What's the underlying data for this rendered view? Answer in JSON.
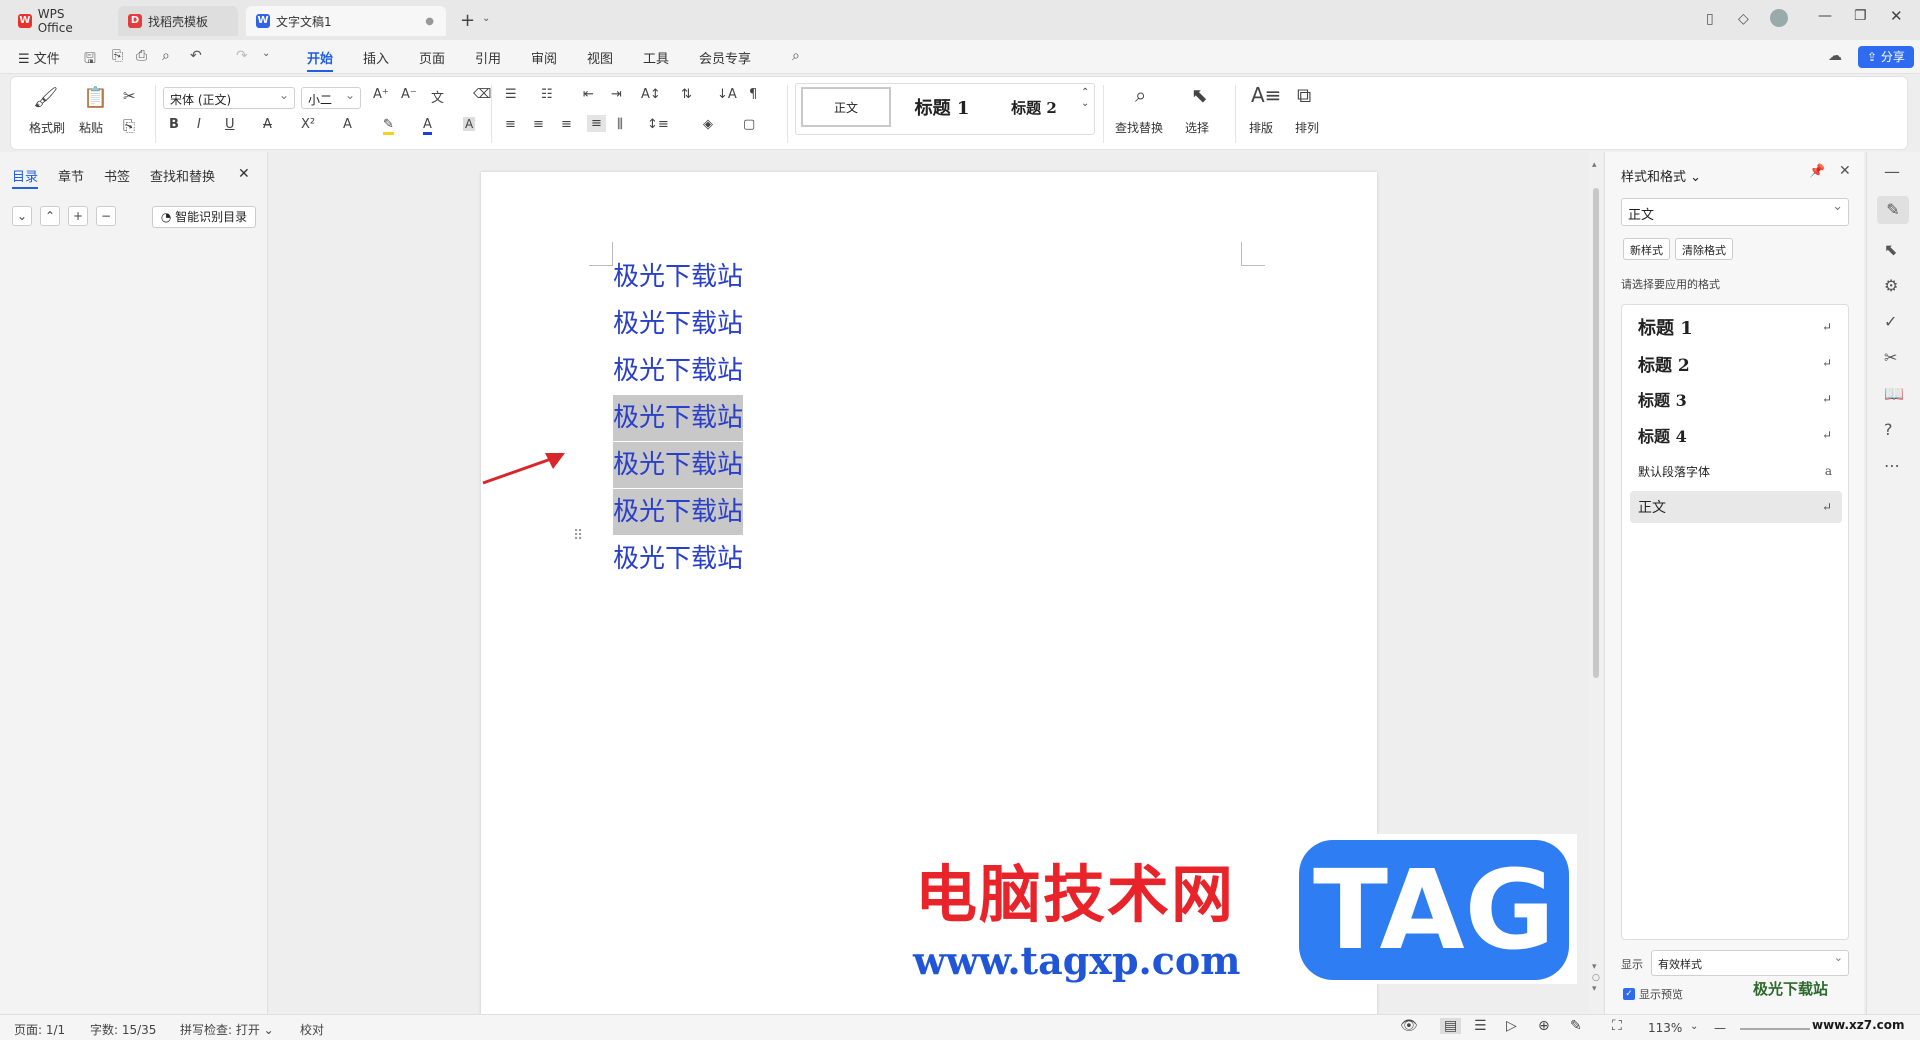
{
  "tabs": [
    {
      "label": "WPS Office",
      "icon": "wps-logo-icon"
    },
    {
      "label": "找稻壳模板",
      "icon": "docer-icon"
    },
    {
      "label": "文字文稿1",
      "icon": "word-doc-icon"
    }
  ],
  "menu": {
    "file": "文件",
    "items": [
      "开始",
      "插入",
      "页面",
      "引用",
      "审阅",
      "视图",
      "工具",
      "会员专享"
    ],
    "active": "开始",
    "share": "分享"
  },
  "ribbon": {
    "format_painter": "格式刷",
    "paste": "粘贴",
    "font_name": "宋体 (正文)",
    "font_size": "小二",
    "styles": [
      "正文",
      "标题 1",
      "标题 2"
    ],
    "find_replace": "查找替换",
    "select": "选择",
    "layout": "排版",
    "arrange": "排列"
  },
  "left_panel": {
    "tabs": [
      "目录",
      "章节",
      "书签",
      "查找和替换"
    ],
    "active_tab": "目录",
    "smart_toc": "智能识别目录"
  },
  "document": {
    "lines": [
      "极光下载站",
      "极光下载站",
      "极光下载站",
      "极光下载站",
      "极光下载站",
      "极光下载站",
      "极光下载站"
    ],
    "selected_lines": [
      4,
      5,
      6
    ],
    "text_color": "#2a40c9",
    "arrow_color": "#d9262a"
  },
  "watermark": {
    "site_title": "电脑技术网",
    "site_url": "www.tagxp.com",
    "tag_logo": "TAG",
    "corner_brand": "极光下载站",
    "corner_url": "www.xz7.com"
  },
  "right_panel": {
    "title": "样式和格式",
    "current_style": "正文",
    "new_style": "新样式",
    "clear_format": "清除格式",
    "prompt": "请选择要应用的格式",
    "styles": [
      {
        "name": "标题 1",
        "mark": "↵"
      },
      {
        "name": "标题 2",
        "mark": "↵"
      },
      {
        "name": "标题 3",
        "mark": "↵"
      },
      {
        "name": "标题 4",
        "mark": "↵"
      },
      {
        "name": "默认段落字体",
        "mark": "a"
      },
      {
        "name": "正文",
        "mark": "↵"
      }
    ],
    "show_label": "显示",
    "show_value": "有效样式",
    "preview_label": "显示预览",
    "preview_checked": true
  },
  "status": {
    "page": "页面: 1/1",
    "words": "字数: 15/35",
    "spell": "拼写检查: 打开",
    "proof": "校对",
    "zoom": "113%"
  }
}
